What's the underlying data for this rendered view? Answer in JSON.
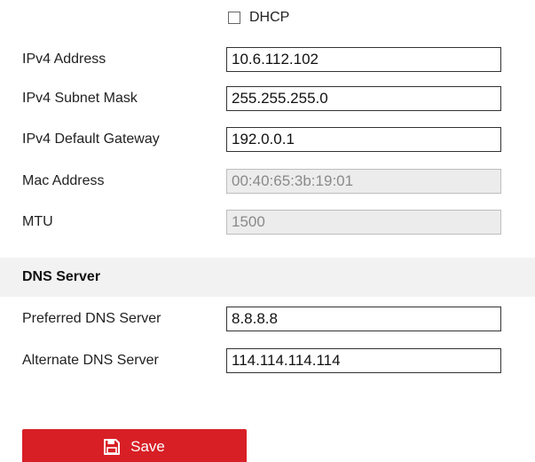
{
  "dhcp": {
    "label": "DHCP",
    "checked": false
  },
  "network_fields": [
    {
      "label": "IPv4 Address",
      "value": "10.6.112.102",
      "editable": true
    },
    {
      "label": "IPv4 Subnet Mask",
      "value": "255.255.255.0",
      "editable": true
    },
    {
      "label": "IPv4 Default Gateway",
      "value": "192.0.0.1",
      "editable": true
    },
    {
      "label": "Mac Address",
      "value": "00:40:65:3b:19:01",
      "editable": false
    },
    {
      "label": "MTU",
      "value": "1500",
      "editable": false
    }
  ],
  "dns_section": {
    "title": "DNS Server",
    "fields": [
      {
        "label": "Preferred DNS Server",
        "value": "8.8.8.8",
        "editable": true
      },
      {
        "label": "Alternate DNS Server",
        "value": "114.114.114.114",
        "editable": true
      }
    ]
  },
  "save_button": {
    "label": "Save",
    "icon": "floppy-disk-icon",
    "color": "#d81f26"
  }
}
